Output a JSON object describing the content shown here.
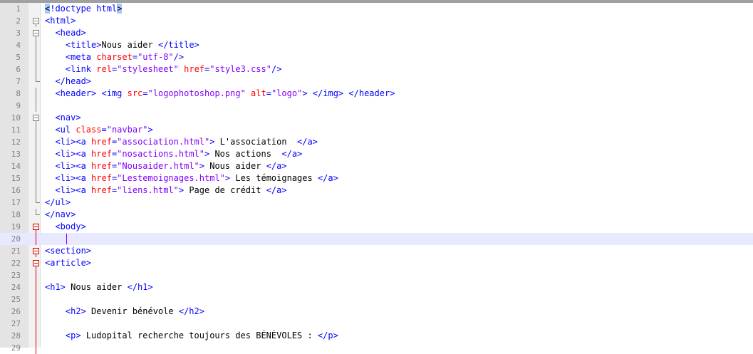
{
  "editor": {
    "lines": [
      {
        "n": "1",
        "indent": "",
        "parts": [
          [
            "hl",
            "<"
          ],
          [
            "tag",
            "!doctype html"
          ],
          [
            "hl",
            ">"
          ]
        ]
      },
      {
        "n": "2",
        "indent": "",
        "parts": [
          [
            "tag",
            "<html>"
          ]
        ]
      },
      {
        "n": "3",
        "indent": "  ",
        "parts": [
          [
            "tag",
            "<head>"
          ]
        ]
      },
      {
        "n": "4",
        "indent": "    ",
        "parts": [
          [
            "tag",
            "<title>"
          ],
          [
            "txt",
            "Nous aider "
          ],
          [
            "tag",
            "</title>"
          ]
        ]
      },
      {
        "n": "5",
        "indent": "    ",
        "parts": [
          [
            "tag",
            "<meta "
          ],
          [
            "attr",
            "charset"
          ],
          [
            "tag",
            "="
          ],
          [
            "val",
            "\"utf-8\""
          ],
          [
            "tag",
            "/>"
          ]
        ]
      },
      {
        "n": "6",
        "indent": "    ",
        "parts": [
          [
            "tag",
            "<link "
          ],
          [
            "attr",
            "rel"
          ],
          [
            "tag",
            "="
          ],
          [
            "val",
            "\"stylesheet\""
          ],
          [
            "txt",
            " "
          ],
          [
            "attr",
            "href"
          ],
          [
            "tag",
            "="
          ],
          [
            "val",
            "\"style3.css\""
          ],
          [
            "tag",
            "/>"
          ]
        ]
      },
      {
        "n": "7",
        "indent": "  ",
        "parts": [
          [
            "tag",
            "</head>"
          ]
        ]
      },
      {
        "n": "8",
        "indent": "  ",
        "parts": [
          [
            "tag",
            "<header>"
          ],
          [
            "txt",
            " "
          ],
          [
            "tag",
            "<img "
          ],
          [
            "attr",
            "src"
          ],
          [
            "tag",
            "="
          ],
          [
            "val",
            "\"logophotoshop.png\""
          ],
          [
            "txt",
            " "
          ],
          [
            "attr",
            "alt"
          ],
          [
            "tag",
            "="
          ],
          [
            "val",
            "\"logo\""
          ],
          [
            "tag",
            ">"
          ],
          [
            "txt",
            " "
          ],
          [
            "tag",
            "</img>"
          ],
          [
            "txt",
            " "
          ],
          [
            "tag",
            "</header>"
          ]
        ]
      },
      {
        "n": "9",
        "indent": "",
        "parts": []
      },
      {
        "n": "10",
        "indent": "  ",
        "parts": [
          [
            "tag",
            "<nav>"
          ]
        ]
      },
      {
        "n": "11",
        "indent": "  ",
        "parts": [
          [
            "tag",
            "<ul "
          ],
          [
            "attr",
            "class"
          ],
          [
            "tag",
            "="
          ],
          [
            "val",
            "\"navbar\""
          ],
          [
            "tag",
            ">"
          ]
        ]
      },
      {
        "n": "12",
        "indent": "  ",
        "parts": [
          [
            "tag",
            "<li><a "
          ],
          [
            "attr",
            "href"
          ],
          [
            "tag",
            "="
          ],
          [
            "val",
            "\"association.html\""
          ],
          [
            "tag",
            ">"
          ],
          [
            "txt",
            " L'association  "
          ],
          [
            "tag",
            "</a>"
          ]
        ]
      },
      {
        "n": "13",
        "indent": "  ",
        "parts": [
          [
            "tag",
            "<li><a "
          ],
          [
            "attr",
            "href"
          ],
          [
            "tag",
            "="
          ],
          [
            "val",
            "\"nosactions.html\""
          ],
          [
            "tag",
            ">"
          ],
          [
            "txt",
            " Nos actions  "
          ],
          [
            "tag",
            "</a>"
          ]
        ]
      },
      {
        "n": "14",
        "indent": "  ",
        "parts": [
          [
            "tag",
            "<li><a "
          ],
          [
            "attr",
            "href"
          ],
          [
            "tag",
            "="
          ],
          [
            "val",
            "\"Nousaider.html\""
          ],
          [
            "tag",
            ">"
          ],
          [
            "txt",
            " Nous aider "
          ],
          [
            "tag",
            "</a>"
          ]
        ]
      },
      {
        "n": "15",
        "indent": "  ",
        "parts": [
          [
            "tag",
            "<li><a "
          ],
          [
            "attr",
            "href"
          ],
          [
            "tag",
            "="
          ],
          [
            "val",
            "\"Lestemoignages.html\""
          ],
          [
            "tag",
            ">"
          ],
          [
            "txt",
            " Les témoignages "
          ],
          [
            "tag",
            "</a>"
          ]
        ]
      },
      {
        "n": "16",
        "indent": "  ",
        "parts": [
          [
            "tag",
            "<li><a "
          ],
          [
            "attr",
            "href"
          ],
          [
            "tag",
            "="
          ],
          [
            "val",
            "\"liens.html\""
          ],
          [
            "tag",
            ">"
          ],
          [
            "txt",
            " Page de crédit "
          ],
          [
            "tag",
            "</a>"
          ]
        ]
      },
      {
        "n": "17",
        "indent": "",
        "parts": [
          [
            "tag",
            "</ul>"
          ]
        ]
      },
      {
        "n": "18",
        "indent": "",
        "parts": [
          [
            "tag",
            "</nav>"
          ]
        ]
      },
      {
        "n": "19",
        "indent": "  ",
        "parts": [
          [
            "tag",
            "<body>"
          ]
        ]
      },
      {
        "n": "20",
        "indent": "    ",
        "parts": []
      },
      {
        "n": "21",
        "indent": "",
        "parts": [
          [
            "tag",
            "<section>"
          ]
        ]
      },
      {
        "n": "22",
        "indent": "",
        "parts": [
          [
            "tag",
            "<article>"
          ]
        ]
      },
      {
        "n": "23",
        "indent": "",
        "parts": []
      },
      {
        "n": "24",
        "indent": "",
        "parts": [
          [
            "tag",
            "<h1>"
          ],
          [
            "txt",
            " Nous aider "
          ],
          [
            "tag",
            "</h1>"
          ]
        ]
      },
      {
        "n": "25",
        "indent": "",
        "parts": []
      },
      {
        "n": "26",
        "indent": "    ",
        "parts": [
          [
            "tag",
            "<h2>"
          ],
          [
            "txt",
            " Devenir bénévole "
          ],
          [
            "tag",
            "</h2>"
          ]
        ]
      },
      {
        "n": "27",
        "indent": "",
        "parts": []
      },
      {
        "n": "28",
        "indent": "    ",
        "parts": [
          [
            "tag",
            "<p>"
          ],
          [
            "txt",
            " Ludopital recherche toujours des BÉNÉVOLES : "
          ],
          [
            "tag",
            "</p>"
          ]
        ]
      },
      {
        "n": "29",
        "indent": "",
        "parts": []
      }
    ],
    "current_line": "20"
  }
}
